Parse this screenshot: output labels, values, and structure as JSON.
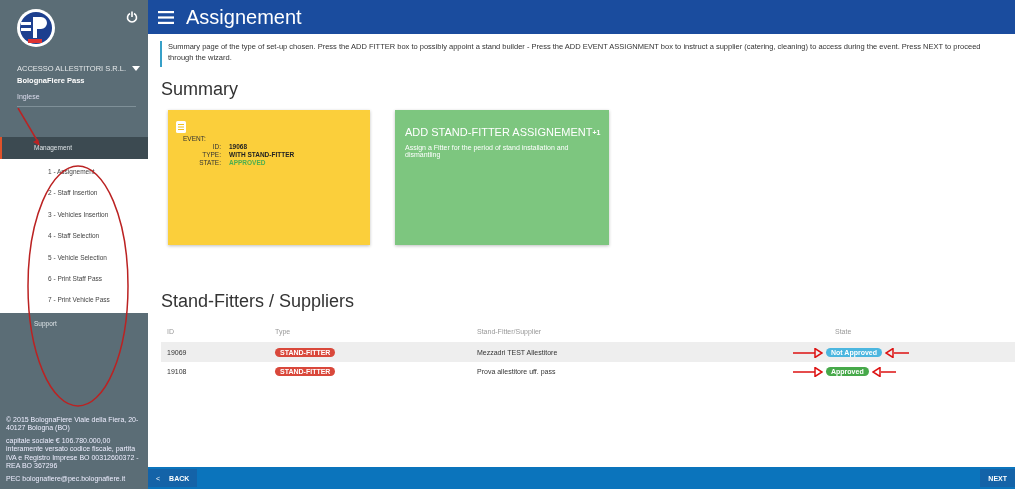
{
  "sidebar": {
    "company": "ACCESSO ALLESTITORI S.R.L.",
    "app_name": "BolognaFiere Pass",
    "language": "Inglese",
    "circled": true,
    "menu": [
      {
        "label": "Management",
        "selected": true,
        "children": [
          {
            "label": "1 - Assignement",
            "selected": false
          },
          {
            "label": "2 - Staff Insertion",
            "selected": false
          },
          {
            "label": "3 - Vehicles Insertion",
            "selected": false
          },
          {
            "label": "4 - Staff Selection",
            "selected": false
          },
          {
            "label": "5 - Vehicle Selection",
            "selected": false
          },
          {
            "label": "6 - Print Staff Pass",
            "selected": false
          },
          {
            "label": "7 - Print Vehicle Pass",
            "selected": false
          }
        ]
      },
      {
        "label": "Support",
        "selected": false
      }
    ],
    "footer": [
      "© 2015 BolognaFiere Viale della Fiera, 20-40127 Bologna (BO)",
      "capitale sociale € 106.780.000,00 interamente versato codice fiscale, partita IVA e Registro Imprese BO 00312600372 - REA BO 367296",
      "PEC bolognafiere@pec.bolognafiere.it"
    ]
  },
  "header": {
    "title": "Assignement"
  },
  "info": "Summary page of the type of set-up chosen. Press the ADD FITTER box to possibly appoint a stand builder - Press the ADD EVENT ASSIGNMENT box to instruct a supplier (catering, cleaning) to access during the event. Press NEXT to proceed through the wizard.",
  "summary": {
    "title": "Summary",
    "event_card": {
      "heading": "EVENT:",
      "fields": [
        {
          "label": "ID:",
          "value": "19068",
          "kind": "plain"
        },
        {
          "label": "TYPE:",
          "value": "WITH STAND-FITTER",
          "kind": "plain"
        },
        {
          "label": "STATE:",
          "value": "APPROVED",
          "kind": "status"
        }
      ]
    },
    "add_card": {
      "title": "ADD STAND-FITTER ASSIGNEMENT",
      "plus": "+1",
      "description": "Assign a Fitter for the period of stand installation and dismantling"
    }
  },
  "suppliers": {
    "title": "Stand-Fitters / Suppliers",
    "columns": [
      "ID",
      "Type",
      "Stand-Fitter/Supplier",
      "State"
    ],
    "rows": [
      {
        "id": "19069",
        "type": "STAND-FITTER",
        "name": "Mezzadri TEST Allestitore",
        "state": "Not Approved",
        "color": "#4bb6df",
        "marked": true,
        "selected": true
      },
      {
        "id": "19108",
        "type": "STAND-FITTER",
        "name": "Prova allestitore uff. pass",
        "state": "Approved",
        "color": "#47a94a",
        "marked": true,
        "selected": false
      }
    ]
  },
  "footer_bar": {
    "back": "BACK",
    "back_icon": "<",
    "next": "NEXT"
  }
}
